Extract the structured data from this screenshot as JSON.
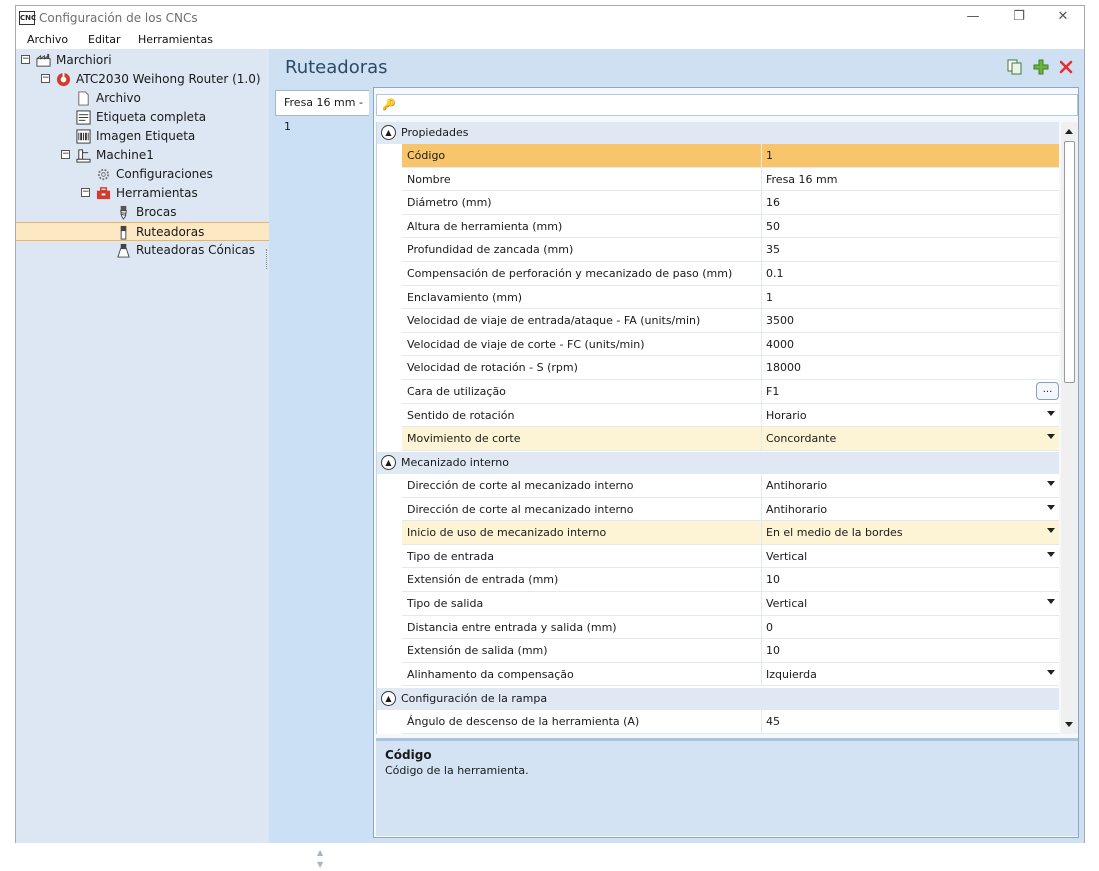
{
  "window": {
    "title": "Configuración de los CNCs",
    "app_icon_text": "CNC",
    "minimize": "—",
    "restore": "❐",
    "close": "✕"
  },
  "menu": [
    "Archivo",
    "Editar",
    "Herramientas"
  ],
  "tree": {
    "root": "Marchiori",
    "machine": "ATC2030 Weihong Router (1.0)",
    "file": "Archivo",
    "full_label": "Etiqueta completa",
    "label_image": "Imagen Etiqueta",
    "machine1": "Machine1",
    "configs": "Configuraciones",
    "tools": "Herramientas",
    "drills": "Brocas",
    "routers": "Ruteadoras",
    "conic_routers": "Ruteadoras Cónicas"
  },
  "header": {
    "title": "Ruteadoras"
  },
  "tab": {
    "label": "Fresa 16 mm - 1"
  },
  "categories": {
    "props": "Propiedades",
    "internal": "Mecanizado interno",
    "ramp": "Configuración de la rampa"
  },
  "props": [
    {
      "name": "Código",
      "value": "1"
    },
    {
      "name": "Nombre",
      "value": "Fresa 16 mm"
    },
    {
      "name": "Diámetro (mm)",
      "value": "16"
    },
    {
      "name": "Altura de herramienta (mm)",
      "value": "50"
    },
    {
      "name": "Profundidad de zancada (mm)",
      "value": "35"
    },
    {
      "name": "Compensación de perforación y mecanizado de paso (mm)",
      "value": "0.1"
    },
    {
      "name": "Enclavamiento (mm)",
      "value": "1"
    },
    {
      "name": "Velocidad de viaje de entrada/ataque - FA (units/min)",
      "value": "3500"
    },
    {
      "name": "Velocidad de viaje de corte - FC (units/min)",
      "value": "4000"
    },
    {
      "name": "Velocidad de rotación - S (rpm)",
      "value": "18000"
    },
    {
      "name": "Cara de utilização",
      "value": "F1"
    },
    {
      "name": "Sentido de rotación",
      "value": "Horario"
    },
    {
      "name": "Movimiento de corte",
      "value": "Concordante"
    }
  ],
  "internal": [
    {
      "name": "Dirección de corte al mecanizado interno",
      "value": "Antihorario"
    },
    {
      "name": "Dirección de corte al mecanizado interno",
      "value": "Antihorario"
    },
    {
      "name": "Inicio de uso de mecanizado interno",
      "value": "En el medio de la bordes"
    },
    {
      "name": "Tipo de entrada",
      "value": "Vertical"
    },
    {
      "name": "Extensión de entrada (mm)",
      "value": "10"
    },
    {
      "name": "Tipo de salida",
      "value": "Vertical"
    },
    {
      "name": "Distancia entre entrada y salida (mm)",
      "value": "0"
    },
    {
      "name": "Extensión de salida (mm)",
      "value": "10"
    },
    {
      "name": "Alinhamento da compensação",
      "value": "Izquierda"
    }
  ],
  "ramp": [
    {
      "name": "Ángulo de descenso de la herramienta (A)",
      "value": "45"
    }
  ],
  "ellipsis": "...",
  "description": {
    "title": "Código",
    "text": "Código de la herramienta."
  }
}
